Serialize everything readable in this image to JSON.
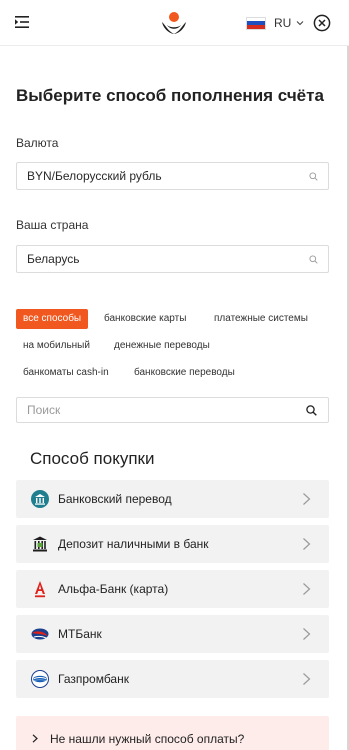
{
  "header": {
    "language": "RU",
    "flag_colors": [
      "#ffffff",
      "#1e4fbf",
      "#d52b1e"
    ],
    "logo_colors": [
      "#f0581f",
      "#1f1f1f"
    ]
  },
  "page": {
    "title": "Выберите способ пополнения счёта"
  },
  "currency": {
    "label": "Валюта",
    "value": "BYN/Белорусский рубль"
  },
  "country": {
    "label": "Ваша страна",
    "value": "Беларусь"
  },
  "filters": {
    "chips": [
      {
        "label": "все способы",
        "active": true
      },
      {
        "label": "банковские карты",
        "active": false
      },
      {
        "label": "платежные системы",
        "active": false
      },
      {
        "label": "на мобильный",
        "active": false
      },
      {
        "label": "денежные переводы",
        "active": false
      },
      {
        "label": "банкоматы cash-in",
        "active": false
      },
      {
        "label": "банковские переводы",
        "active": false
      }
    ],
    "accent_color": "#f0581f"
  },
  "search": {
    "placeholder": "Поиск",
    "value": ""
  },
  "methods": {
    "title": "Способ покупки",
    "items": [
      {
        "label": "Банковский перевод",
        "icon": "bank-building-icon"
      },
      {
        "label": "Депозит наличными в банк",
        "icon": "cash-deposit-icon"
      },
      {
        "label": "Альфа-Банк (карта)",
        "icon": "alfa-bank-icon"
      },
      {
        "label": "МТБанк",
        "icon": "mtbank-icon"
      },
      {
        "label": "Газпромбанк",
        "icon": "gazprombank-icon"
      }
    ]
  },
  "help": {
    "label": "Не нашли нужный способ оплаты?"
  }
}
